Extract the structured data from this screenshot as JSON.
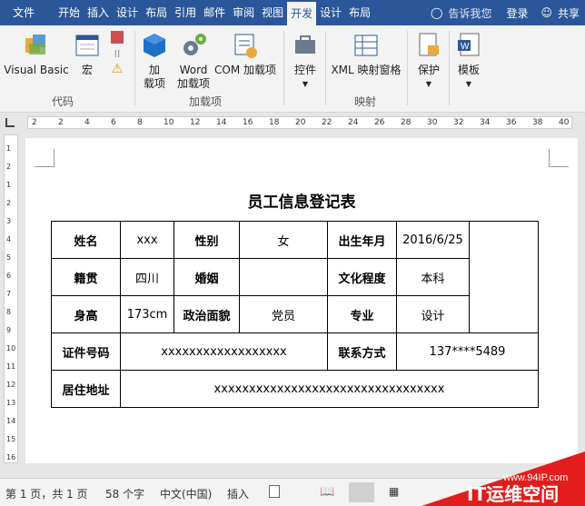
{
  "tabs": [
    "文件",
    "开始",
    "插入",
    "设计",
    "布局",
    "引用",
    "邮件",
    "审阅",
    "视图",
    "开发",
    "设计",
    "布局"
  ],
  "tabbar_right": {
    "tell_me": "告诉我您",
    "login": "登录",
    "share": "共享"
  },
  "ribbon": {
    "visual_basic": "Visual Basic",
    "macro": "宏",
    "addin": [
      "加",
      "载项"
    ],
    "word_addin": [
      "Word",
      "加载项"
    ],
    "com_addin": "COM 加载项",
    "controls": "控件",
    "xml_pane": "XML 映射窗格",
    "protect": "保护",
    "template": "模板",
    "groups": {
      "code": "代码",
      "addins": "加载项",
      "mapping": "映射"
    }
  },
  "ruler_h": [
    "2",
    "2",
    "4",
    "6",
    "8",
    "10",
    "12",
    "14",
    "16",
    "18",
    "20",
    "22",
    "24",
    "26",
    "28",
    "30",
    "32",
    "34",
    "36",
    "38",
    "40"
  ],
  "ruler_v": [
    "1",
    "2",
    "1",
    "2",
    "3",
    "4",
    "5",
    "6",
    "7",
    "8",
    "9",
    "10",
    "11",
    "12",
    "13",
    "14",
    "15",
    "16"
  ],
  "doc": {
    "title": "员工信息登记表",
    "r1": [
      "姓名",
      "xxx",
      "性别",
      "女",
      "出生年月",
      "2016/6/25"
    ],
    "r2": [
      "籍贯",
      "四川",
      "婚姻",
      "",
      "文化程度",
      "本科"
    ],
    "r3": [
      "身高",
      "173cm",
      "政治面貌",
      "党员",
      "专业",
      "设计"
    ],
    "r4": [
      "证件号码",
      "xxxxxxxxxxxxxxxxxx",
      "联系方式",
      "137****5489"
    ],
    "r5": [
      "居住地址",
      "xxxxxxxxxxxxxxxxxxxxxxxxxxxxxxxxx"
    ]
  },
  "status": {
    "page": "第 1 页，共 1 页",
    "words": "58 个字",
    "lang": "中文(中国)",
    "insert": "插入"
  },
  "watermark": {
    "url": "www.94IP.com",
    "brand": "IT运维空间"
  }
}
